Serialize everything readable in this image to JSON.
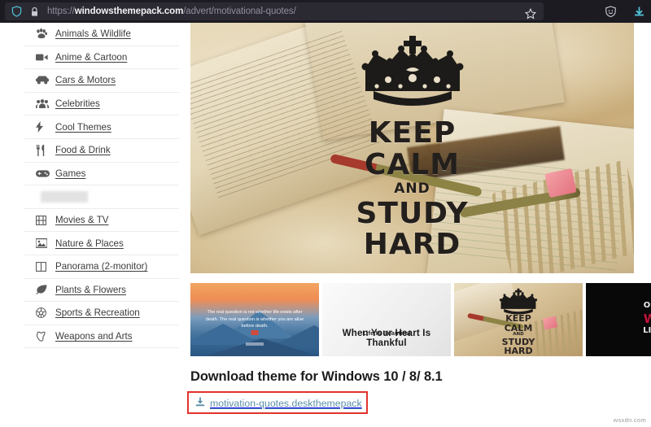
{
  "browser": {
    "url_prefix": "https://",
    "url_host": "windowsthemepack.com",
    "url_path": "/advert/motivational-quotes/",
    "shield_icon": "shield-icon",
    "lock_icon": "lock-icon",
    "bookmark_icon": "star-icon",
    "container_icon": "shield-face-icon",
    "downloads_icon": "download-arrow-icon",
    "accent_teal": "#4ec2d5",
    "bar_bg": "#1c1b22",
    "urlbar_bg": "#2b2a33"
  },
  "sidebar": {
    "items": [
      {
        "label": "Animals & Wildlife",
        "icon": "paw-icon"
      },
      {
        "label": "Anime & Cartoon",
        "icon": "video-camera-icon"
      },
      {
        "label": "Cars & Motors",
        "icon": "car-icon"
      },
      {
        "label": "Celebrities",
        "icon": "people-group-icon"
      },
      {
        "label": "Cool Themes",
        "icon": "lightning-bolt-icon"
      },
      {
        "label": "Food & Drink",
        "icon": "fork-knife-icon"
      },
      {
        "label": "Games",
        "icon": "gamepad-icon"
      },
      {
        "label": "",
        "icon": "redacted"
      },
      {
        "label": "Movies & TV",
        "icon": "film-strip-icon"
      },
      {
        "label": "Nature & Places",
        "icon": "picture-icon"
      },
      {
        "label": "Panorama (2-monitor)",
        "icon": "two-columns-icon"
      },
      {
        "label": "Plants & Flowers",
        "icon": "leaf-icon"
      },
      {
        "label": "Sports & Recreation",
        "icon": "ball-icon"
      },
      {
        "label": "Weapons and Arts",
        "icon": "shield-sword-icon"
      }
    ]
  },
  "banner": {
    "line1": "KEEP",
    "line2": "CALM",
    "and": "AND",
    "line3": "STUDY",
    "line4": "HARD",
    "crown_icon": "crown-icon",
    "alt": "Keep Calm and Study Hard over open books and notes"
  },
  "thumbnails": [
    {
      "name": "thumb-mountain-quote",
      "quote": "The real question is not whether life exists after death. The real question is whether you are alive before death."
    },
    {
      "name": "thumb-life-is-beautiful",
      "line1": "Life Is Beautiful",
      "line2": "When Your Heart Is Thankful"
    },
    {
      "name": "thumb-keep-calm",
      "line1": "KEEP",
      "line2": "CALM",
      "and": "AND",
      "line3": "STUDY",
      "line4": "HARD"
    },
    {
      "name": "thumb-dark-quote",
      "line1": "OU",
      "line2": "W",
      "line3": "LIB",
      "accent": "#c2123b"
    }
  ],
  "download": {
    "heading": "Download theme for Windows 10 / 8/ 8.1",
    "file_link": "motivation-quotes.deskthemepack",
    "download_icon": "download-icon",
    "highlight_color": "#e2332b"
  },
  "footer": {
    "watermark": "wsxdn.com"
  }
}
